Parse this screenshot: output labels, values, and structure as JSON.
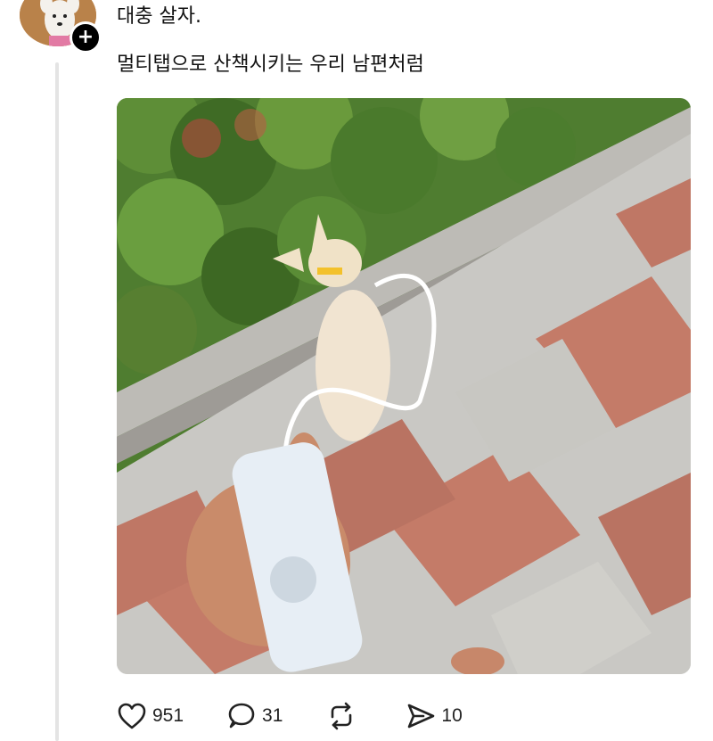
{
  "post": {
    "lines": [
      "대충 살자.",
      "멀티탭으로 산책시키는 우리 남편처럼"
    ]
  },
  "author": {
    "avatar_icon": "dog-avatar",
    "follow_symbol": "+"
  },
  "actions": {
    "likes": "951",
    "replies": "31",
    "reposts": "",
    "shares": "10"
  },
  "icons": {
    "like": "heart-icon",
    "reply": "comment-icon",
    "repost": "repost-icon",
    "share": "send-icon"
  },
  "colors": {
    "icon": "#222222",
    "thread_line": "#e4e4e4"
  }
}
